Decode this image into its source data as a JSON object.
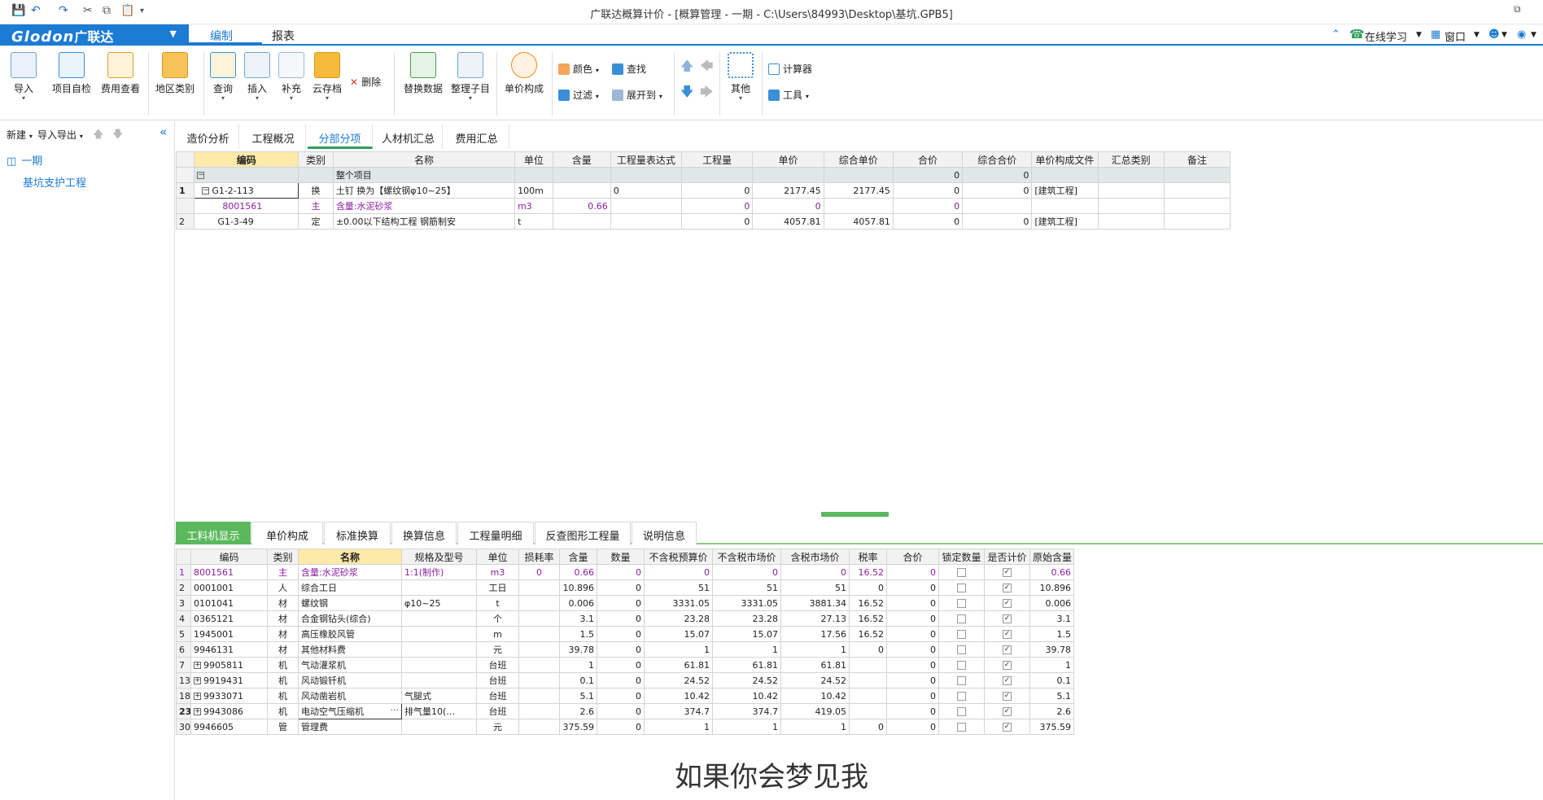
{
  "titlebar": {
    "title": "广联达概算计价 - [概算管理 - 一期 - C:\\Users\\84993\\Desktop\\基坑.GPB5]"
  },
  "menubar": {
    "logo": "Glodon",
    "logo_cn": "广联达",
    "tabs": [
      "编制",
      "报表"
    ],
    "right": {
      "online": "在线学习",
      "window": "窗口"
    }
  },
  "ribbon": {
    "import": "导入",
    "self_check": "项目自检",
    "fee_view": "费用查看",
    "region": "地区类别",
    "query": "查询",
    "insert": "插入",
    "supplement": "补充",
    "cloud": "云存档",
    "delete": "删除",
    "replace": "替换数据",
    "arrange": "整理子目",
    "unit_price": "单价构成",
    "color": "颜色",
    "find": "查找",
    "filter": "过滤",
    "expand": "展开到",
    "other": "其他",
    "calc": "计算器",
    "tools": "工具"
  },
  "leftpanel": {
    "new": "新建",
    "import_export": "导入导出",
    "tree": [
      {
        "label": "一期"
      },
      {
        "label": "基坑支护工程"
      }
    ]
  },
  "main_tabs": [
    "造价分析",
    "工程概况",
    "分部分项",
    "人材机汇总",
    "费用汇总"
  ],
  "upper_grid": {
    "headers": [
      "编码",
      "类别",
      "名称",
      "单位",
      "含量",
      "工程量表达式",
      "工程量",
      "单价",
      "综合单价",
      "合价",
      "综合合价",
      "单价构成文件",
      "汇总类别",
      "备注"
    ],
    "total_row": {
      "name": "整个项目",
      "total": "0",
      "comp_total": "0"
    },
    "rows": [
      {
        "rn": "1",
        "code": "G1-2-113",
        "type": "换",
        "name": "土钉  换为【螺纹钢φ10~25】",
        "unit": "100m",
        "content": "",
        "expr": "0",
        "qty": "0",
        "price": "2177.45",
        "comp_price": "2177.45",
        "total": "0",
        "comp_total": "0",
        "file": "[建筑工程]",
        "cat": "",
        "note": ""
      },
      {
        "rn": "",
        "code": "8001561",
        "type": "主",
        "name": "含量:水泥砂浆",
        "unit": "m3",
        "content": "0.66",
        "expr": "",
        "qty": "0",
        "price": "0",
        "comp_price": "",
        "total": "0",
        "comp_total": "",
        "file": "",
        "cat": "",
        "note": ""
      },
      {
        "rn": "2",
        "code": "G1-3-49",
        "type": "定",
        "name": "±0.00以下结构工程 钢筋制安",
        "unit": "t",
        "content": "",
        "expr": "",
        "qty": "0",
        "price": "4057.81",
        "comp_price": "4057.81",
        "total": "0",
        "comp_total": "0",
        "file": "[建筑工程]",
        "cat": "",
        "note": ""
      }
    ]
  },
  "bottom_tabs": [
    "工料机显示",
    "单价构成",
    "标准换算",
    "换算信息",
    "工程量明细",
    "反查图形工程量",
    "说明信息"
  ],
  "lower_grid": {
    "headers": [
      "编码",
      "类别",
      "名称",
      "规格及型号",
      "单位",
      "损耗率",
      "含量",
      "数量",
      "不含税预算价",
      "不含税市场价",
      "含税市场价",
      "税率",
      "合价",
      "锁定数量",
      "是否计价",
      "原始含量"
    ],
    "rows": [
      {
        "rn": "1",
        "code": "8001561",
        "type": "主",
        "name": "含量:水泥砂浆",
        "spec": "1:1(制作)",
        "unit": "m3",
        "loss": "0",
        "content": "0.66",
        "qty": "0",
        "budget": "0",
        "market": "0",
        "market_tax": "0",
        "tax": "16.52",
        "total": "0",
        "orig": "0.66",
        "purple": true,
        "expand": false
      },
      {
        "rn": "2",
        "code": "0001001",
        "type": "人",
        "name": "综合工日",
        "spec": "",
        "unit": "工日",
        "loss": "",
        "content": "10.896",
        "qty": "0",
        "budget": "51",
        "market": "51",
        "market_tax": "51",
        "tax": "0",
        "total": "0",
        "orig": "10.896",
        "purple": false,
        "expand": false
      },
      {
        "rn": "3",
        "code": "0101041",
        "type": "材",
        "name": "螺纹钢",
        "spec": "φ10~25",
        "unit": "t",
        "loss": "",
        "content": "0.006",
        "qty": "0",
        "budget": "3331.05",
        "market": "3331.05",
        "market_tax": "3881.34",
        "tax": "16.52",
        "total": "0",
        "orig": "0.006",
        "purple": false,
        "expand": false
      },
      {
        "rn": "4",
        "code": "0365121",
        "type": "材",
        "name": "合金钢钻头(综合)",
        "spec": "",
        "unit": "个",
        "loss": "",
        "content": "3.1",
        "qty": "0",
        "budget": "23.28",
        "market": "23.28",
        "market_tax": "27.13",
        "tax": "16.52",
        "total": "0",
        "orig": "3.1",
        "purple": false,
        "expand": false
      },
      {
        "rn": "5",
        "code": "1945001",
        "type": "材",
        "name": "高压橡胶风管",
        "spec": "",
        "unit": "m",
        "loss": "",
        "content": "1.5",
        "qty": "0",
        "budget": "15.07",
        "market": "15.07",
        "market_tax": "17.56",
        "tax": "16.52",
        "total": "0",
        "orig": "1.5",
        "purple": false,
        "expand": false
      },
      {
        "rn": "6",
        "code": "9946131",
        "type": "材",
        "name": "其他材料费",
        "spec": "",
        "unit": "元",
        "loss": "",
        "content": "39.78",
        "qty": "0",
        "budget": "1",
        "market": "1",
        "market_tax": "1",
        "tax": "0",
        "total": "0",
        "orig": "39.78",
        "purple": false,
        "expand": false
      },
      {
        "rn": "7",
        "code": "9905811",
        "type": "机",
        "name": "气动灌浆机",
        "spec": "",
        "unit": "台班",
        "loss": "",
        "content": "1",
        "qty": "0",
        "budget": "61.81",
        "market": "61.81",
        "market_tax": "61.81",
        "tax": "",
        "total": "0",
        "orig": "1",
        "purple": false,
        "expand": true
      },
      {
        "rn": "13",
        "code": "9919431",
        "type": "机",
        "name": "风动锻钎机",
        "spec": "",
        "unit": "台班",
        "loss": "",
        "content": "0.1",
        "qty": "0",
        "budget": "24.52",
        "market": "24.52",
        "market_tax": "24.52",
        "tax": "",
        "total": "0",
        "orig": "0.1",
        "purple": false,
        "expand": true
      },
      {
        "rn": "18",
        "code": "9933071",
        "type": "机",
        "name": "风动凿岩机",
        "spec": "气腿式",
        "unit": "台班",
        "loss": "",
        "content": "5.1",
        "qty": "0",
        "budget": "10.42",
        "market": "10.42",
        "market_tax": "10.42",
        "tax": "",
        "total": "0",
        "orig": "5.1",
        "purple": false,
        "expand": true
      },
      {
        "rn": "23",
        "code": "9943086",
        "type": "机",
        "name": "电动空气压缩机",
        "spec": "排气量10(…",
        "unit": "台班",
        "loss": "",
        "content": "2.6",
        "qty": "0",
        "budget": "374.7",
        "market": "374.7",
        "market_tax": "419.05",
        "tax": "",
        "total": "0",
        "orig": "2.6",
        "purple": false,
        "expand": true
      },
      {
        "rn": "30",
        "code": "9946605",
        "type": "管",
        "name": "管理费",
        "spec": "",
        "unit": "元",
        "loss": "",
        "content": "375.59",
        "qty": "0",
        "budget": "1",
        "market": "1",
        "market_tax": "1",
        "tax": "0",
        "total": "0",
        "orig": "375.59",
        "purple": false,
        "expand": false
      }
    ]
  },
  "subtitle": "如果你会梦见我",
  "colors": {
    "brand": "#1c7bd3",
    "active_green": "#5cb85c",
    "purple": "#8b1fa0"
  }
}
